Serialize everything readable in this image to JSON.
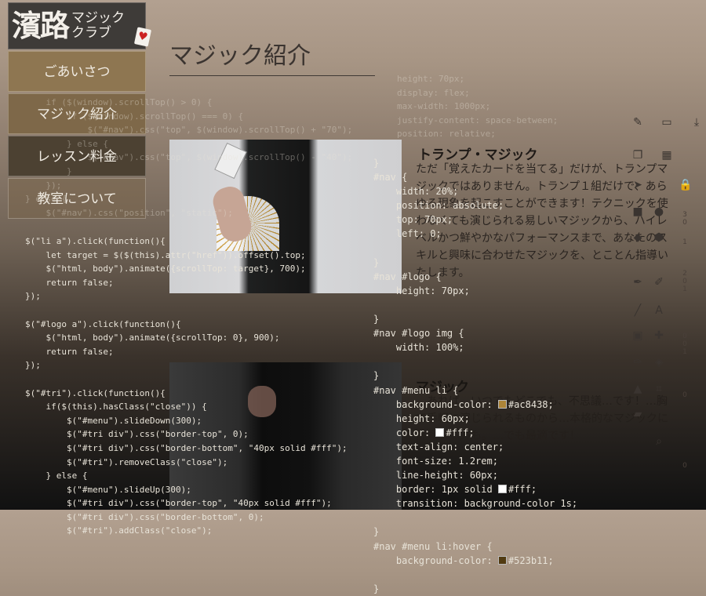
{
  "logo": {
    "main": "濱路",
    "sub_line1": "マジック",
    "sub_line2": "クラブ",
    "heart": "♥"
  },
  "menu": [
    {
      "label": "ごあいさつ"
    },
    {
      "label": "マジック紹介"
    },
    {
      "label": "レッスン料金"
    },
    {
      "label": "教室について"
    }
  ],
  "page": {
    "title": "マジック紹介"
  },
  "section1": {
    "title": "トランプ・マジック",
    "body": "ただ「覚えたカードを当てる」だけが、トランプマジックではありません。トランプ１組だけで、あらゆる現象を起こすことができます！テクニックを使わなくても演じられる易しいマジックから、ハイレベルかつ鮮やかなパフォーマンスまで、あなたのスキルと興味に合わせたマジックを、とことん指導いたします。"
  },
  "section2": {
    "title": "マジック",
    "body": "…あれば、いつでもどこでも、不思議…です！…胸で手軽に演じられるものから…本格的なマジックに挑戦する方も。…でも最適です！"
  },
  "code": {
    "js_top": "    if ($(window).scrollTop() > 0) {\n        if ($(window).scrollTop() === 0) {\n            $(\"#nav\").css(\"top\", $(window).scrollTop() + \"70\");\n        } else {\n            $(\"#nav\").css(\"top\", $(window).scrollTop() - \"40\");\n        }\n    });\n} else {\n    $(\"#nav\").css(\"position\", \"static\");",
    "js_main": "$(\"li a\").click(function(){\n    let target = $($(this).attr(\"href\")).offset().top;\n    $(\"html, body\").animate({scrollTop: target}, 700);\n    return false;\n});\n\n$(\"#logo a\").click(function(){\n    $(\"html, body\").animate({scrollTop: 0}, 900);\n    return false;\n});\n\n$(\"#tri\").click(function(){\n    if($(this).hasClass(\"close\")) {\n        $(\"#menu\").slideDown(300);\n        $(\"#tri div\").css(\"border-top\", 0);\n        $(\"#tri div\").css(\"border-bottom\", \"40px solid #fff\");\n        $(\"#tri\").removeClass(\"close\");\n    } else {\n        $(\"#menu\").slideUp(300);\n        $(\"#tri div\").css(\"border-top\", \"40px solid #fff\");\n        $(\"#tri div\").css(\"border-bottom\", 0);\n        $(\"#tri\").addClass(\"close\");",
    "css_top": "height: 70px;\ndisplay: flex;\nmax-width: 1000px;\njustify-content: space-between;\nposition: relative;",
    "css_main_lines": [
      {
        "t": "}"
      },
      {
        "t": "#nav {"
      },
      {
        "t": "    width: 20%;"
      },
      {
        "t": "    position: absolute;"
      },
      {
        "t": "    top: 70px;"
      },
      {
        "t": "    left: 0;"
      },
      {
        "t": ""
      },
      {
        "t": "}"
      },
      {
        "t": "#nav #logo {"
      },
      {
        "t": "    height: 70px;"
      },
      {
        "t": ""
      },
      {
        "t": "}"
      },
      {
        "t": "#nav #logo img {"
      },
      {
        "t": "    width: 100%;"
      },
      {
        "t": ""
      },
      {
        "t": "}"
      },
      {
        "t": "#nav #menu li {"
      },
      {
        "t": "    background-color: #ac8438;",
        "swatch": "#ac8438"
      },
      {
        "t": "    height: 60px;"
      },
      {
        "t": "    color: #fff;",
        "swatch": "#ffffff"
      },
      {
        "t": "    text-align: center;"
      },
      {
        "t": "    font-size: 1.2rem;"
      },
      {
        "t": "    line-height: 60px;"
      },
      {
        "t": "    border: 1px solid #fff;",
        "swatch": "#ffffff"
      },
      {
        "t": "    transition: background-color 1s;"
      },
      {
        "t": ""
      },
      {
        "t": "}"
      },
      {
        "t": "#nav #menu li:hover {"
      },
      {
        "t": "    background-color: #523b11;",
        "swatch": "#523b11"
      },
      {
        "t": ""
      },
      {
        "t": "}"
      }
    ]
  },
  "tools": [
    "edit-icon",
    "folder-icon",
    "download-icon",
    "copy-icon",
    "grid-icon",
    "cursor-icon",
    "lock-icon",
    "square-icon",
    "circle-icon",
    "pin-icon",
    "hexagon-icon",
    "pen-icon",
    "brush-icon",
    "line-icon",
    "text-icon",
    "image-icon",
    "plus-icon",
    "eyedropper-icon",
    "fill-icon",
    "stamp-icon",
    "crop-icon",
    "eraser-icon",
    "zoom-icon"
  ],
  "ruler": [
    "3",
    "0",
    "1",
    "2",
    "0",
    "1",
    "0",
    "0",
    "1",
    "0",
    "0"
  ]
}
